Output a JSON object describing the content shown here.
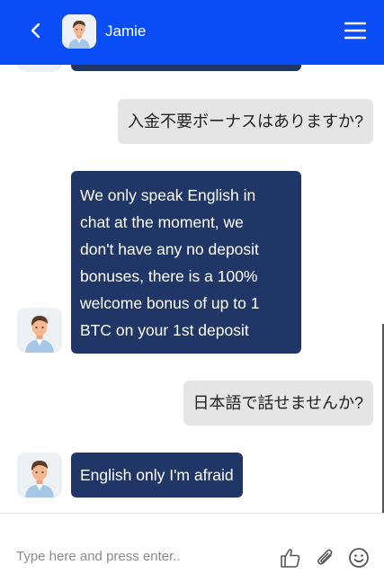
{
  "header": {
    "agent_name": "Jamie",
    "back_icon": "chevron-left-icon",
    "menu_icon": "hamburger-menu-icon",
    "background": "#0a4cf5"
  },
  "messages": [
    {
      "sender": "user",
      "text": "入金不要ボーナスはありますか?"
    },
    {
      "sender": "agent",
      "lines": [
        "We only speak English in",
        "chat at the moment, we",
        "don't have any no deposit",
        "bonuses, there is a 100%",
        "welcome bonus of up to 1",
        "BTC on your 1st deposit"
      ]
    },
    {
      "sender": "user",
      "text": "日本語で話せませんか?"
    },
    {
      "sender": "agent",
      "lines": [
        "English only I'm afraid"
      ]
    }
  ],
  "composer": {
    "placeholder": "Type here and press enter..",
    "icons": [
      "thumbs-up-icon",
      "paperclip-icon",
      "emoji-icon"
    ]
  },
  "colors": {
    "agent_bubble": "#1f3666",
    "user_bubble": "#e5e5e5"
  }
}
